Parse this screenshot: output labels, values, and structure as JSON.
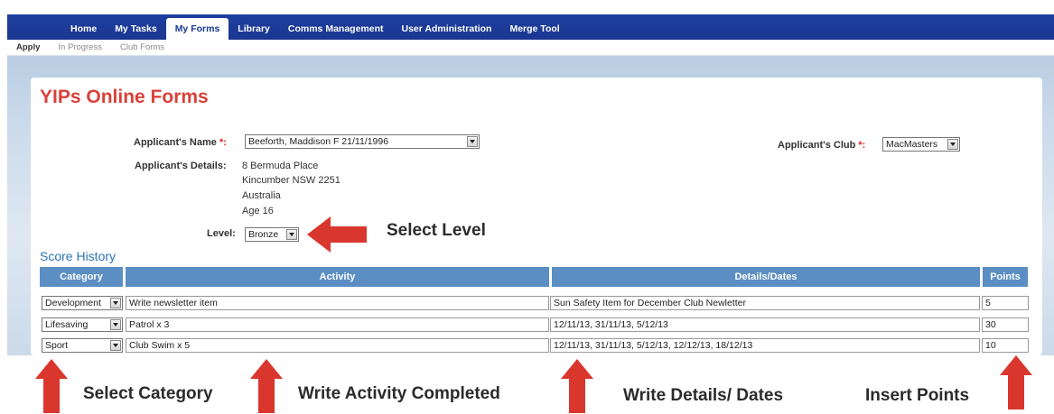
{
  "nav": {
    "items": [
      {
        "label": "Home",
        "active": false
      },
      {
        "label": "My Tasks",
        "active": false
      },
      {
        "label": "My Forms",
        "active": true
      },
      {
        "label": "Library",
        "active": false
      },
      {
        "label": "Comms Management",
        "active": false
      },
      {
        "label": "User Administration",
        "active": false
      },
      {
        "label": "Merge Tool",
        "active": false
      }
    ]
  },
  "subnav": {
    "items": [
      {
        "label": "Apply",
        "active": true
      },
      {
        "label": "In Progress",
        "active": false
      },
      {
        "label": "Club Forms",
        "active": false
      }
    ]
  },
  "page": {
    "title": "YIPs Online Forms"
  },
  "form": {
    "applicant_name_label": "Applicant's Name",
    "applicant_name_value": "Beeforth, Maddison F 21/11/1996",
    "required_mark": "*:",
    "applicant_club_label": "Applicant's Club",
    "applicant_club_value": "MacMasters",
    "details_label": "Applicant's Details:",
    "details_lines": [
      "8 Bermuda Place",
      "Kincumber NSW 2251",
      "Australia",
      "Age  16"
    ],
    "level_label": "Level:",
    "level_value": "Bronze"
  },
  "score_history": {
    "title": "Score History",
    "columns": [
      "Category",
      "Activity",
      "Details/Dates",
      "Points"
    ],
    "rows": [
      {
        "category": "Development",
        "activity": "Write newsletter item",
        "details": "Sun Safety Item for December Club Newletter",
        "points": "5"
      },
      {
        "category": "Lifesaving",
        "activity": "Patrol x 3",
        "details": "12/11/13, 31/11/13, 5/12/13",
        "points": "30"
      },
      {
        "category": "Sport",
        "activity": "Club Swim x 5",
        "details": "12/11/13, 31/11/13, 5/12/13, 12/12/13, 18/12/13",
        "points": "10"
      }
    ]
  },
  "annotations": {
    "select_level": "Select Level",
    "select_category": "Select Category",
    "write_activity": "Write Activity Completed",
    "write_details": "Write Details/ Dates",
    "insert_points": "Insert Points"
  },
  "colors": {
    "nav_bg": "#1a3690",
    "title_red": "#d9413a",
    "table_header": "#5b8ec2",
    "arrow_red": "#d9362e"
  }
}
